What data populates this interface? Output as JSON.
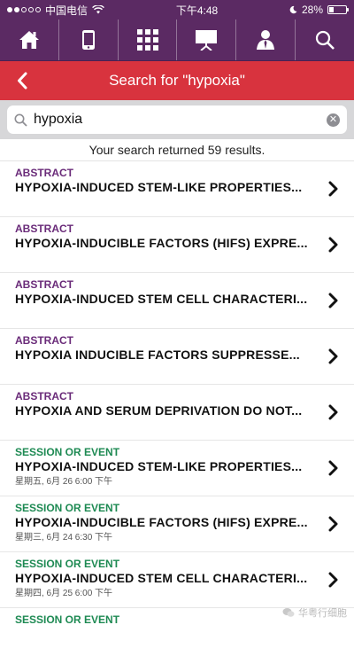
{
  "status_bar": {
    "carrier": "中国电信",
    "time": "下午4:48",
    "battery": "28%",
    "battery_level": 0.28
  },
  "nav_icons": [
    "home-icon",
    "mobile-device-icon",
    "grid-icon",
    "presentation-board-icon",
    "speaker-person-icon",
    "search-icon"
  ],
  "title_bar": {
    "title": "Search for \"hypoxia\""
  },
  "search": {
    "value": "hypoxia",
    "placeholder": ""
  },
  "summary": "Your search returned 59 results.",
  "results": [
    {
      "category": "ABSTRACT",
      "title": "HYPOXIA-INDUCED STEM-LIKE PROPERTIES...",
      "date": ""
    },
    {
      "category": "ABSTRACT",
      "title": "HYPOXIA-INDUCIBLE FACTORS (HIFS) EXPRE...",
      "date": ""
    },
    {
      "category": "ABSTRACT",
      "title": "HYPOXIA-INDUCED STEM CELL CHARACTERI...",
      "date": ""
    },
    {
      "category": "ABSTRACT",
      "title": "HYPOXIA INDUCIBLE FACTORS SUPPRESSE...",
      "date": ""
    },
    {
      "category": "ABSTRACT",
      "title": "HYPOXIA AND SERUM DEPRIVATION DO NOT...",
      "date": ""
    },
    {
      "category": "SESSION OR EVENT",
      "title": "HYPOXIA-INDUCED STEM-LIKE PROPERTIES...",
      "date": "星期五, 6月 26 6:00 下午"
    },
    {
      "category": "SESSION OR EVENT",
      "title": "HYPOXIA-INDUCIBLE FACTORS (HIFS) EXPRE...",
      "date": "星期三, 6月 24 6:30 下午"
    },
    {
      "category": "SESSION OR EVENT",
      "title": "HYPOXIA-INDUCED STEM CELL CHARACTERI...",
      "date": "星期四, 6月 25 6:00 下午"
    },
    {
      "category": "SESSION OR EVENT",
      "title": "",
      "date": ""
    }
  ],
  "watermark": "华粤行细胞",
  "colors": {
    "nav_bg": "#5b2a63",
    "title_bg": "#d8333e",
    "abstract": "#6a2b79",
    "session": "#1e8a53"
  }
}
